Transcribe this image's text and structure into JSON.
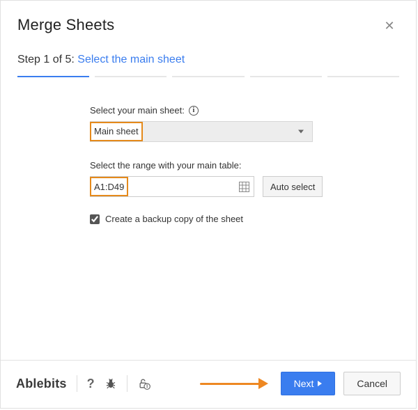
{
  "header": {
    "title": "Merge Sheets"
  },
  "step": {
    "prefix": "Step 1 of 5:",
    "name": "Select the main sheet",
    "current": 1,
    "total": 5
  },
  "form": {
    "main_sheet_label": "Select your main sheet:",
    "main_sheet_value": "Main sheet",
    "range_label": "Select the range with your main table:",
    "range_value": "A1:D49",
    "auto_select_label": "Auto select",
    "backup_checked": true,
    "backup_label": "Create a backup copy of the sheet"
  },
  "footer": {
    "brand": "Ablebits",
    "next_label": "Next",
    "cancel_label": "Cancel"
  },
  "colors": {
    "accent": "#3a7def",
    "highlight": "#e58a1b",
    "annotation": "#ee8822"
  }
}
